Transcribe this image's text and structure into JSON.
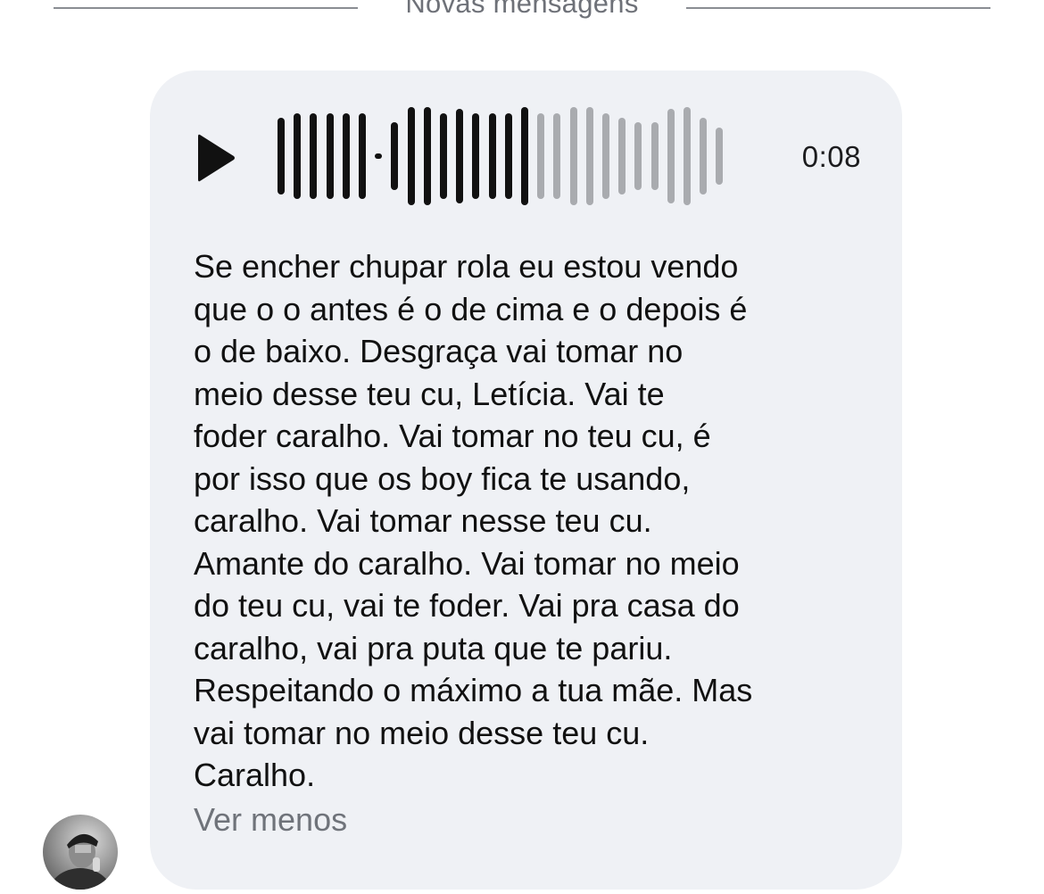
{
  "divider": {
    "label": "Novas mensagens"
  },
  "audio_message": {
    "duration": "0:08",
    "played_fraction": 0.58,
    "colors": {
      "played": "#111111",
      "unplayed": "#a9abaf"
    },
    "play_icon": "play-icon"
  },
  "transcript": {
    "text": "Se encher chupar rola eu estou vendo\nque o o antes é o de cima e o depois é\no de baixo. Desgraça vai tomar no\nmeio desse teu cu, Letícia. Vai te\nfoder caralho. Vai tomar no teu cu, é\npor isso que os boy fica te usando,\ncaralho. Vai tomar nesse teu cu.\nAmante do caralho. Vai tomar no meio\ndo teu cu, vai te foder. Vai pra casa do\ncaralho, vai pra puta que te pariu.\nRespeitando o máximo a tua mãe. Mas\nvai tomar no meio desse teu cu.\nCaralho.",
    "toggle_label": "Ver menos"
  },
  "colors": {
    "bubble_background": "#eff1f5",
    "divider": "#8a8d93",
    "secondary_text": "#6f737a"
  }
}
